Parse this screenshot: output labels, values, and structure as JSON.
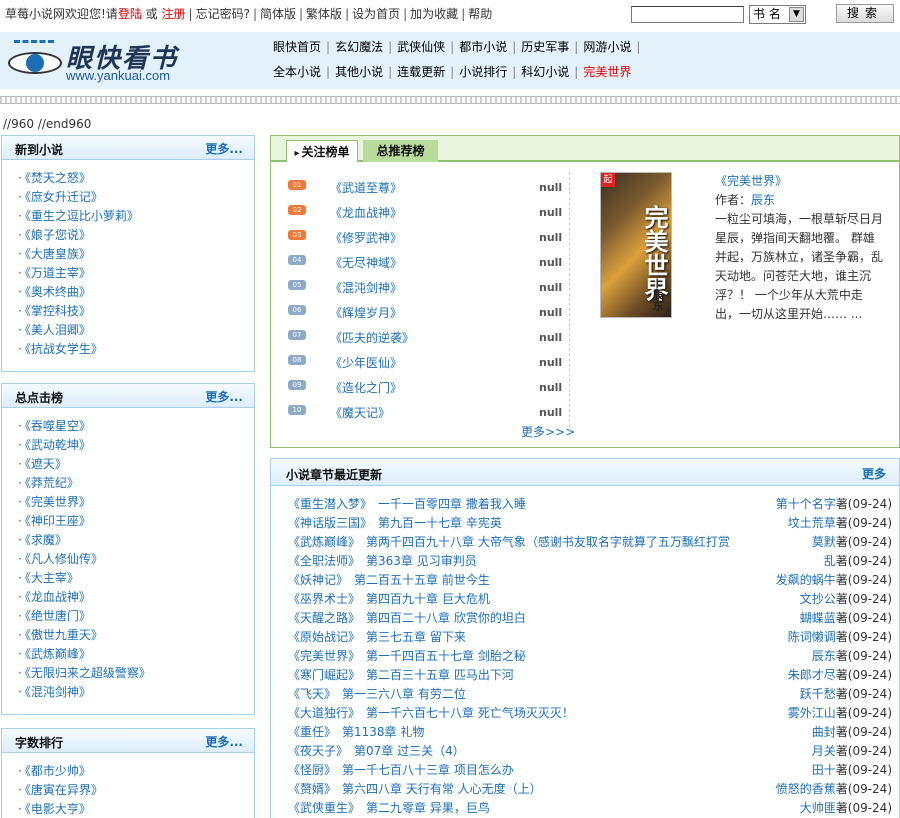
{
  "topbar": {
    "welcome": "草莓小说网欢迎您!请",
    "login": "登陆",
    "or": "或",
    "register": "注册",
    "forgot": "忘记密码?",
    "simplified": "简体版",
    "traditional": "繁体版",
    "set_home": "设为首页",
    "favorite": "加为收藏",
    "help": "帮助",
    "search_value": "",
    "search_type": "书 名",
    "search_button": "搜索"
  },
  "logo": {
    "cn": "眼快看书",
    "en": "www.yankuai.com"
  },
  "nav": {
    "row1": [
      "眼快首页",
      "玄幻魔法",
      "武侠仙侠",
      "都市小说",
      "历史军事",
      "网游小说"
    ],
    "row2": [
      "全本小说",
      "其他小说",
      "连载更新",
      "小说排行",
      "科幻小说",
      "完美世界"
    ],
    "active": "完美世界"
  },
  "comment_text": "//960 //end960",
  "left": {
    "new": {
      "title": "新到小说",
      "more": "更多...",
      "items": [
        "《焚天之怒》",
        "《庶女升迁记》",
        "《重生之逗比小萝莉》",
        "《娘子您说》",
        "《大唐皇族》",
        "《万道主宰》",
        "《奥术终曲》",
        "《掌控科技》",
        "《美人泪卿》",
        "《抗战女学生》"
      ]
    },
    "hits": {
      "title": "总点击榜",
      "more": "更多...",
      "items": [
        "《吞噬星空》",
        "《武动乾坤》",
        "《遮天》",
        "《莽荒纪》",
        "《完美世界》",
        "《神印王座》",
        "《求魔》",
        "《凡人修仙传》",
        "《大主宰》",
        "《龙血战神》",
        "《绝世唐门》",
        "《傲世九重天》",
        "《武炼巅峰》",
        "《无限归来之超级警察》",
        "《混沌剑神》"
      ]
    },
    "words": {
      "title": "字数排行",
      "more": "更多...",
      "items": [
        "《都市少帅》",
        "《唐寅在异界》",
        "《电影大亨》"
      ]
    }
  },
  "rank": {
    "tabs": [
      "关注榜单",
      "总推荐榜"
    ],
    "items": [
      {
        "num": "01",
        "title": "《武道至尊》",
        "val": "null"
      },
      {
        "num": "02",
        "title": "《龙血战神》",
        "val": "null"
      },
      {
        "num": "03",
        "title": "《修罗武神》",
        "val": "null"
      },
      {
        "num": "04",
        "title": "《无尽神域》",
        "val": "null"
      },
      {
        "num": "05",
        "title": "《混沌剑神》",
        "val": "null"
      },
      {
        "num": "06",
        "title": "《辉煌岁月》",
        "val": "null"
      },
      {
        "num": "07",
        "title": "《匹夫的逆袭》",
        "val": "null"
      },
      {
        "num": "08",
        "title": "《少年医仙》",
        "val": "null"
      },
      {
        "num": "09",
        "title": "《造化之门》",
        "val": "null"
      },
      {
        "num": "10",
        "title": "《魔天记》",
        "val": "null"
      }
    ],
    "more": "更多>>>",
    "featured": {
      "cover_title": "完美世界",
      "cover_author": "—辰东",
      "title": "《完美世界》",
      "author_label": "作者：",
      "author": "辰东",
      "desc": "一粒尘可填海，一根草斩尽日月星辰，弹指间天翻地覆。 群雄并起，万族林立，诸圣争霸，乱天动地。问苍茫大地，谁主沉浮？！ 一个少年从大荒中走出，一切从这里开始…… ..."
    }
  },
  "updates": {
    "title": "小说章节最近更新",
    "more": "更多",
    "rows": [
      {
        "book": "《重生潜入梦》",
        "chapter": "一千一百零四章 撒着我入睡",
        "author": "第十个名字",
        "date": "著(09-24)"
      },
      {
        "book": "《神话版三国》",
        "chapter": "第九百一十七章 辛宪英",
        "author": "坟土荒草",
        "date": "著(09-24)"
      },
      {
        "book": "《武炼巅峰》",
        "chapter": "第两千四百九十八章 大帝气象（感谢书友取名字就算了五万飘红打赏",
        "author": "莫默",
        "date": "著(09-24)"
      },
      {
        "book": "《全职法师》",
        "chapter": "第363章 见习审判员",
        "author": "乱",
        "date": "著(09-24)"
      },
      {
        "book": "《妖神记》",
        "chapter": "第二百五十五章 前世今生",
        "author": "发飙的蜗牛",
        "date": "著(09-24)"
      },
      {
        "book": "《巫界术士》",
        "chapter": "第四百九十章 巨大危机",
        "author": "文抄公",
        "date": "著(09-24)"
      },
      {
        "book": "《天醒之路》",
        "chapter": "第四百二十八章 欣赏你的坦白",
        "author": "蝴蝶蓝",
        "date": "著(09-24)"
      },
      {
        "book": "《原始战记》",
        "chapter": "第三七五章 留下来",
        "author": "陈词懒调",
        "date": "著(09-24)"
      },
      {
        "book": "《完美世界》",
        "chapter": "第一千四百五十七章 剑胎之秘",
        "author": "辰东",
        "date": "著(09-24)"
      },
      {
        "book": "《寒门崛起》",
        "chapter": "第二百三十五章 匹马出下河",
        "author": "朱郎才尽",
        "date": "著(09-24)"
      },
      {
        "book": "《飞天》",
        "chapter": "第一三六八章 有劳二位",
        "author": "跃千愁",
        "date": "著(09-24)"
      },
      {
        "book": "《大道独行》",
        "chapter": "第一千六百七十八章 死亡气场灭灭灭！",
        "author": "雾外江山",
        "date": "著(09-24)"
      },
      {
        "book": "《重任》",
        "chapter": "第1138章 礼物",
        "author": "曲封",
        "date": "著(09-24)"
      },
      {
        "book": "《夜天子》",
        "chapter": "第07章 过三关（4）",
        "author": "月关",
        "date": "著(09-24)"
      },
      {
        "book": "《怪厨》",
        "chapter": "第一千七百八十三章 项目怎么办",
        "author": "田十",
        "date": "著(09-24)"
      },
      {
        "book": "《赘婿》",
        "chapter": "第六四八章 天行有常 人心无度（上）",
        "author": "愤怒的香蕉",
        "date": "著(09-24)"
      },
      {
        "book": "《武侠重生》",
        "chapter": "第二九零章 异果，巨鸟",
        "author": "大帅匪",
        "date": "著(09-24)"
      }
    ]
  }
}
